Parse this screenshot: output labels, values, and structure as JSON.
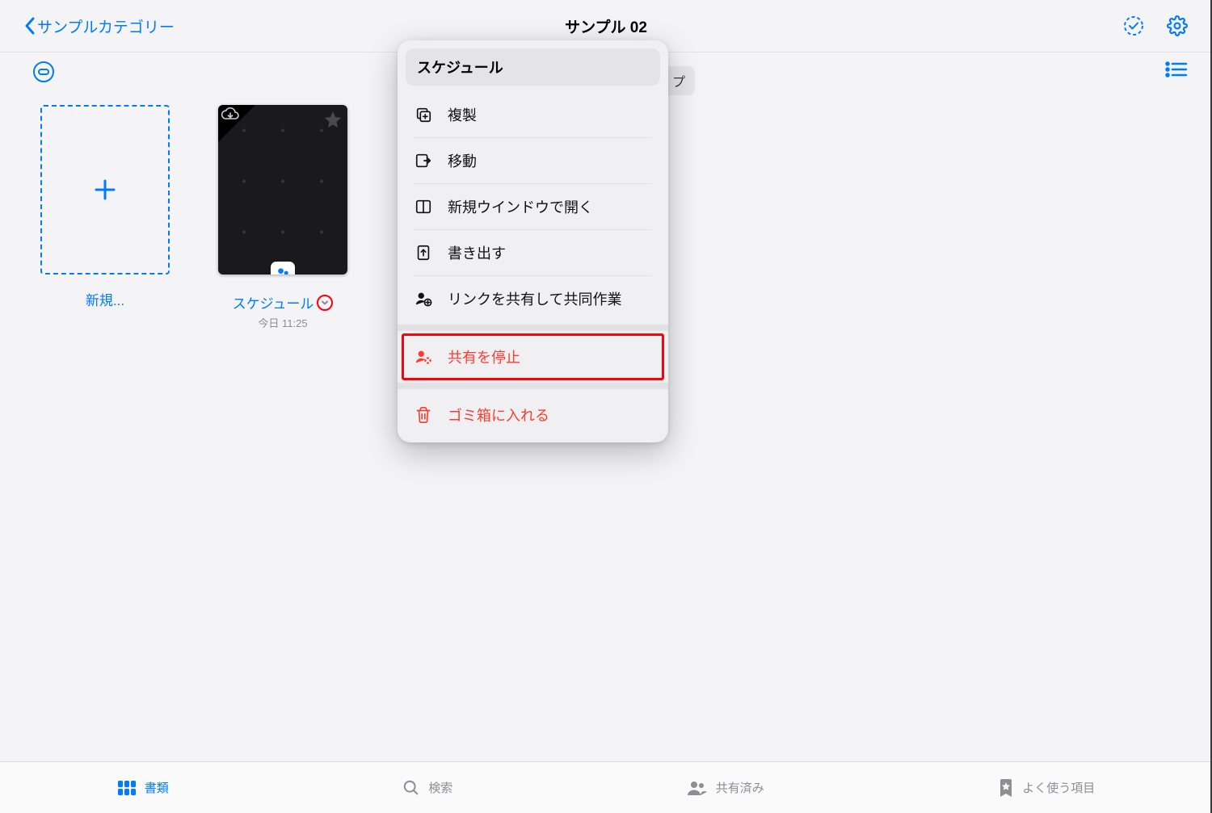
{
  "header": {
    "back_label": "サンプルカテゴリー",
    "page_title": "サンプル 02"
  },
  "hidden_tab_fragment": "プ",
  "tiles": {
    "new_label": "新規...",
    "doc": {
      "name": "スケジュール",
      "date": "今日 11:25"
    }
  },
  "popup": {
    "title": "スケジュール",
    "items": [
      {
        "id": "duplicate",
        "label": "複製",
        "icon": "duplicate-icon",
        "destructive": false
      },
      {
        "id": "move",
        "label": "移動",
        "icon": "move-icon",
        "destructive": false
      },
      {
        "id": "open-new-window",
        "label": "新規ウインドウで開く",
        "icon": "window-icon",
        "destructive": false
      },
      {
        "id": "export",
        "label": "書き出す",
        "icon": "export-icon",
        "destructive": false
      },
      {
        "id": "share-collab",
        "label": "リンクを共有して共同作業",
        "icon": "share-link-icon",
        "destructive": false
      },
      {
        "id": "stop-sharing",
        "label": "共有を停止",
        "icon": "stop-share-icon",
        "destructive": true,
        "highlighted": true
      },
      {
        "id": "trash",
        "label": "ゴミ箱に入れる",
        "icon": "trash-icon",
        "destructive": true
      }
    ]
  },
  "tabs": [
    {
      "id": "documents",
      "label": "書類",
      "active": true
    },
    {
      "id": "search",
      "label": "検索",
      "active": false
    },
    {
      "id": "shared",
      "label": "共有済み",
      "active": false
    },
    {
      "id": "favorites",
      "label": "よく使う項目",
      "active": false
    }
  ]
}
